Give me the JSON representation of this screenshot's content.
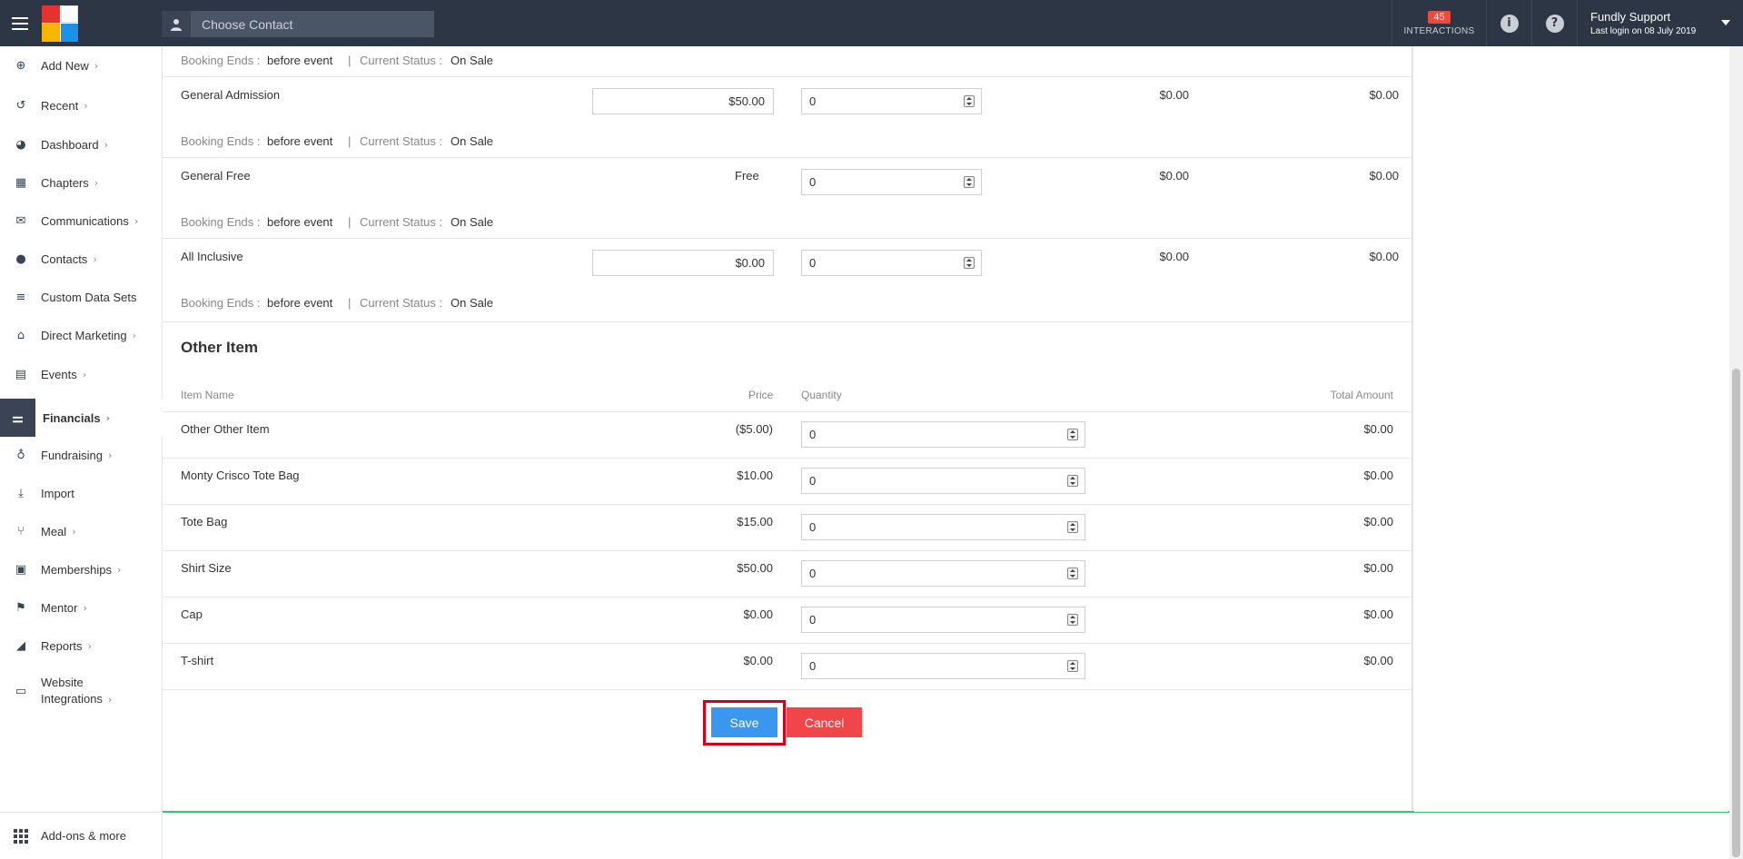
{
  "topbar": {
    "search_placeholder": "Choose Contact",
    "interactions_count": "45",
    "interactions_label": "INTERACTIONS",
    "info_icon": "i",
    "help_icon": "?",
    "user_name": "Fundly Support",
    "last_login": "Last login on 08 July 2019"
  },
  "sidebar": {
    "items": [
      {
        "label": "Add New",
        "icon": "plus-circle-icon",
        "glyph": "⊕"
      },
      {
        "label": "Recent",
        "icon": "history-icon",
        "glyph": "↺"
      },
      {
        "label": "Dashboard",
        "icon": "dashboard-icon",
        "glyph": "◕"
      },
      {
        "label": "Chapters",
        "icon": "grid-icon",
        "glyph": "▦"
      },
      {
        "label": "Communications",
        "icon": "envelope-icon",
        "glyph": "✉"
      },
      {
        "label": "Contacts",
        "icon": "person-icon",
        "glyph": "●"
      },
      {
        "label": "Custom Data Sets",
        "icon": "layers-icon",
        "glyph": "≡"
      },
      {
        "label": "Direct Marketing",
        "icon": "building-icon",
        "glyph": "⌂"
      },
      {
        "label": "Events",
        "icon": "calendar-icon",
        "glyph": "▤"
      },
      {
        "label": "Financials",
        "icon": "money-icon",
        "glyph": "⚌"
      },
      {
        "label": "Fundraising",
        "icon": "money-bag-icon",
        "glyph": "♁"
      },
      {
        "label": "Import",
        "icon": "import-icon",
        "glyph": "⤓"
      },
      {
        "label": "Meal",
        "icon": "fork-knife-icon",
        "glyph": "⑂"
      },
      {
        "label": "Memberships",
        "icon": "id-card-icon",
        "glyph": "▣"
      },
      {
        "label": "Mentor",
        "icon": "running-icon",
        "glyph": "⚑"
      },
      {
        "label": "Reports",
        "icon": "chart-icon",
        "glyph": "◢"
      },
      {
        "label_line1": "Website",
        "label_line2": "Integrations",
        "icon": "window-icon",
        "glyph": "▭"
      }
    ],
    "addons_label": "Add-ons & more"
  },
  "tickets": {
    "booking_label": "Booking Ends :",
    "booking_value": "before event",
    "separator": "|",
    "status_label": "Current Status :",
    "status_value": "On Sale",
    "rows": [
      {
        "name": "General Admission",
        "price": "$50.00",
        "qty": "0",
        "amount1": "$0.00",
        "amount2": "$0.00"
      },
      {
        "name": "General Free",
        "price": "Free",
        "qty": "0",
        "amount1": "$0.00",
        "amount2": "$0.00"
      },
      {
        "name": "All Inclusive",
        "price": "$0.00",
        "qty": "0",
        "amount1": "$0.00",
        "amount2": "$0.00"
      }
    ]
  },
  "other_items": {
    "title": "Other Item",
    "headers": {
      "name": "Item Name",
      "price": "Price",
      "quantity": "Quantity",
      "total": "Total Amount"
    },
    "rows": [
      {
        "name": "Other Other Item",
        "price": "($5.00)",
        "qty": "0",
        "total": "$0.00"
      },
      {
        "name": "Monty Crisco Tote Bag",
        "price": "$10.00",
        "qty": "0",
        "total": "$0.00"
      },
      {
        "name": "Tote Bag",
        "price": "$15.00",
        "qty": "0",
        "total": "$0.00"
      },
      {
        "name": "Shirt Size",
        "price": "$50.00",
        "qty": "0",
        "total": "$0.00"
      },
      {
        "name": "Cap",
        "price": "$0.00",
        "qty": "0",
        "total": "$0.00"
      },
      {
        "name": "T-shirt",
        "price": "$0.00",
        "qty": "0",
        "total": "$0.00"
      }
    ]
  },
  "actions": {
    "save_label": "Save",
    "cancel_label": "Cancel"
  },
  "colors": {
    "topbar": "#2d3645",
    "save": "#3a97f0",
    "cancel": "#f0464a",
    "highlight": "#d0021b",
    "badge": "#e74c3c"
  }
}
